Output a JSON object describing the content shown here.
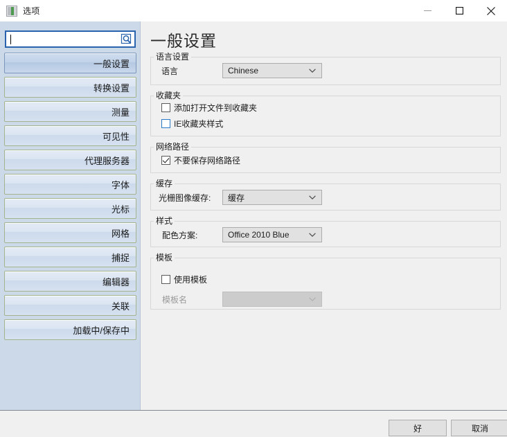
{
  "window": {
    "title": "选项",
    "icon": "options-app-icon",
    "minimize_label": "minimize-icon",
    "maximize_label": "maximize-icon",
    "close_label": "close-icon"
  },
  "sidebar": {
    "search": {
      "value": "",
      "placeholder": "",
      "icon": "search-icon"
    },
    "items": [
      {
        "label": "一般设置",
        "selected": true
      },
      {
        "label": "转换设置",
        "selected": false
      },
      {
        "label": "测量",
        "selected": false
      },
      {
        "label": "可见性",
        "selected": false
      },
      {
        "label": "代理服务器",
        "selected": false
      },
      {
        "label": "字体",
        "selected": false
      },
      {
        "label": "光标",
        "selected": false
      },
      {
        "label": "网格",
        "selected": false
      },
      {
        "label": "捕捉",
        "selected": false
      },
      {
        "label": "编辑器",
        "selected": false
      },
      {
        "label": "关联",
        "selected": false
      },
      {
        "label": "加载中/保存中",
        "selected": false
      }
    ]
  },
  "main": {
    "page_title": "一般设置",
    "groups": {
      "language": {
        "legend": "语言设置",
        "language_label": "语言",
        "language_value": "Chinese"
      },
      "favorites": {
        "legend": "收藏夹",
        "add_open_file_label": "添加打开文件到收藏夹",
        "add_open_file_checked": false,
        "ie_style_label": "IE收藏夹样式",
        "ie_style_checked": false,
        "ie_style_hover": true
      },
      "network": {
        "legend": "网络路径",
        "dont_save_label": "不要保存网络路径",
        "dont_save_checked": true
      },
      "cache": {
        "legend": "缓存",
        "raster_cache_label": "光栅图像缓存:",
        "raster_cache_value": "缓存"
      },
      "style": {
        "legend": "样式",
        "color_scheme_label": "配色方案:",
        "color_scheme_value": "Office 2010 Blue"
      },
      "template": {
        "legend": "模板",
        "use_template_label": "使用模板",
        "use_template_checked": false,
        "template_name_label": "模板名",
        "template_name_value": "",
        "template_name_disabled": true
      }
    }
  },
  "footer": {
    "ok_label": "好",
    "cancel_label": "取消"
  },
  "colors": {
    "sidebar_background": "#ccd9e8",
    "panel_background": "#f0f0f0",
    "search_border": "#2a63ad",
    "nav_border": "#a3b38d",
    "checkbox_hover_border": "#2a78c8"
  }
}
